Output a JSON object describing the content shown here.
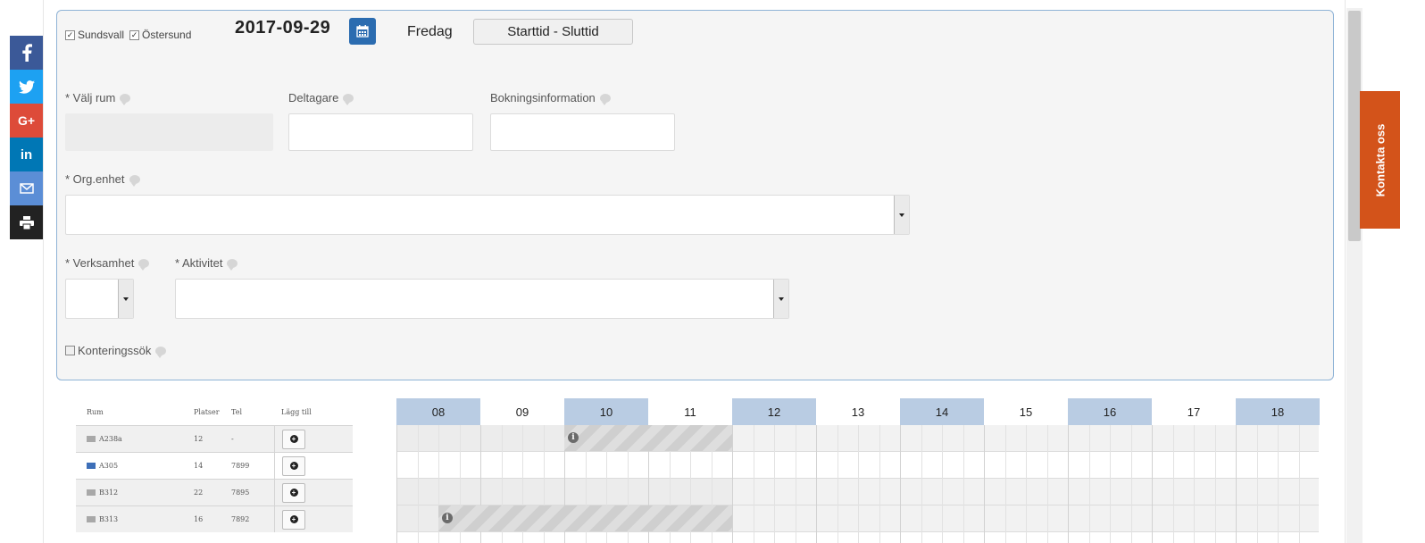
{
  "social": {
    "items": [
      {
        "name": "facebook",
        "glyph": "f",
        "color": "#3b5998"
      },
      {
        "name": "twitter",
        "glyph": "",
        "color": "#1da1f2"
      },
      {
        "name": "google-plus",
        "glyph": "G+",
        "color": "#dd4b39"
      },
      {
        "name": "linkedin",
        "glyph": "in",
        "color": "#0077b5"
      },
      {
        "name": "email",
        "glyph": "",
        "color": "#5b8ed6"
      },
      {
        "name": "print",
        "glyph": "",
        "color": "#222222"
      }
    ]
  },
  "filters": {
    "locations": [
      {
        "label": "Sundsvall",
        "checked": true
      },
      {
        "label": "Östersund",
        "checked": true
      }
    ],
    "date": "2017-09-29",
    "day": "Fredag",
    "time_button": "Starttid - Sluttid"
  },
  "form": {
    "room_label": "* Välj rum",
    "participants_label": "Deltagare",
    "booking_info_label": "Bokningsinformation",
    "org_unit_label": "* Org.enhet",
    "business_label": "* Verksamhet",
    "activity_label": "* Aktivitet",
    "account_search_label": "Konteringssök",
    "account_search_checked": false
  },
  "contact_tab": "Kontakta oss",
  "rooms": {
    "headers": {
      "room": "Rum",
      "seats": "Platser",
      "phone": "Tel",
      "add": "Lägg till"
    },
    "rows": [
      {
        "room": "A238a",
        "seats": "12",
        "phone": "-",
        "icon": "gray"
      },
      {
        "room": "A305",
        "seats": "14",
        "phone": "7899",
        "icon": "blue"
      },
      {
        "room": "B312",
        "seats": "22",
        "phone": "7895",
        "icon": "gray"
      },
      {
        "room": "B313",
        "seats": "16",
        "phone": "7892",
        "icon": "gray"
      }
    ]
  },
  "schedule": {
    "hours": [
      "08",
      "09",
      "10",
      "11",
      "12",
      "13",
      "14",
      "15",
      "16",
      "17",
      "18"
    ],
    "highlighted_hours": [
      "08",
      "10",
      "12",
      "14",
      "16",
      "18"
    ],
    "bookings": [
      {
        "row": 0,
        "start": "10:00",
        "end": "12:00",
        "info_icon": "info-icon"
      },
      {
        "row": 3,
        "start": "08:30",
        "end": "12:00",
        "info_icon": "info-icon"
      }
    ],
    "shaded_rows": [
      0,
      2,
      3
    ],
    "shaded_until": "12:00"
  }
}
